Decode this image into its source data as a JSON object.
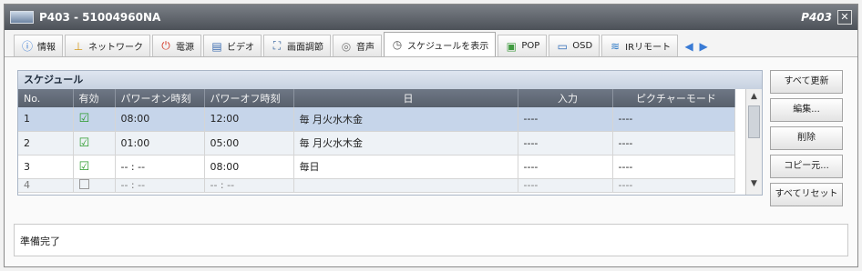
{
  "window": {
    "title": "P403 - 51004960NA",
    "title_right": "P403",
    "close_icon": "close-icon"
  },
  "tabs": [
    {
      "label": "情報",
      "icon": "info-icon"
    },
    {
      "label": "ネットワーク",
      "icon": "network-icon"
    },
    {
      "label": "電源",
      "icon": "power-icon"
    },
    {
      "label": "ビデオ",
      "icon": "video-icon"
    },
    {
      "label": "画面調節",
      "icon": "screen-adjust-icon"
    },
    {
      "label": "音声",
      "icon": "audio-icon"
    },
    {
      "label": "スケジュールを表示",
      "icon": "clock-icon",
      "active": true
    },
    {
      "label": "POP",
      "icon": "pop-icon"
    },
    {
      "label": "OSD",
      "icon": "osd-icon"
    },
    {
      "label": "IRリモート",
      "icon": "ir-remote-icon"
    }
  ],
  "panel": {
    "title": "スケジュール",
    "columns": [
      "No.",
      "有効",
      "パワーオン時刻",
      "パワーオフ時刻",
      "日",
      "入力",
      "ピクチャーモード"
    ],
    "rows": [
      {
        "no": "1",
        "enabled": true,
        "on": "08:00",
        "off": "12:00",
        "day": "毎 月火水木金",
        "input": "----",
        "mode": "----"
      },
      {
        "no": "2",
        "enabled": true,
        "on": "01:00",
        "off": "05:00",
        "day": "毎 月火水木金",
        "input": "----",
        "mode": "----"
      },
      {
        "no": "3",
        "enabled": true,
        "on": "-- : --",
        "off": "08:00",
        "day": "毎日",
        "input": "----",
        "mode": "----"
      },
      {
        "no": "4",
        "enabled": false,
        "on": "-- : --",
        "off": "-- : --",
        "day": "",
        "input": "----",
        "mode": "----"
      }
    ]
  },
  "buttons": {
    "refresh_all": "すべて更新",
    "edit": "編集...",
    "delete": "削除",
    "copy": "コピー元...",
    "reset_all": "すべてリセット"
  },
  "status": {
    "text": "準備完了"
  }
}
